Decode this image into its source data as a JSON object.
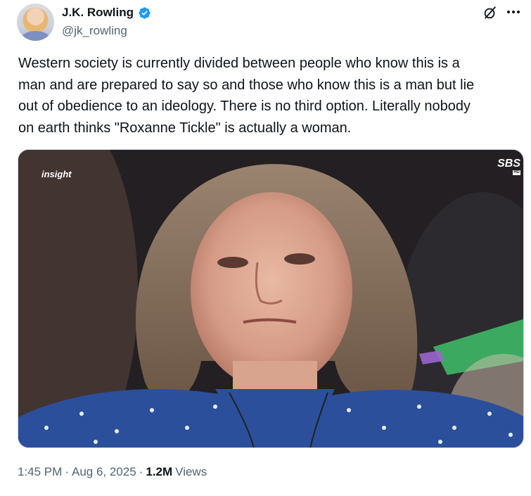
{
  "author": {
    "display_name": "J.K. Rowling",
    "handle": "@jk_rowling",
    "verified": true,
    "avatar_icon": "avatar-photo"
  },
  "header_actions": {
    "grok_icon": "grok-icon",
    "more_icon": "more-options-icon"
  },
  "tweet": {
    "text": "Western society is currently divided between people who know this is a\nman and are prepared to say so and those who know this is a man but lie\nout of obedience to an ideology. There is no third option. Literally nobody\non earth thinks \"Roxanne Tickle\" is actually a woman."
  },
  "media": {
    "watermark_left": "insight",
    "watermark_right": "SBS",
    "watermark_right_sub": "HD"
  },
  "meta": {
    "time": "1:45 PM",
    "separator": "·",
    "date": "Aug 6, 2025",
    "views_count": "1.2M",
    "views_label": "Views"
  },
  "colors": {
    "text_primary": "#0f1419",
    "text_secondary": "#536471",
    "verified_blue": "#1d9bf0",
    "border": "#cfd9de"
  }
}
